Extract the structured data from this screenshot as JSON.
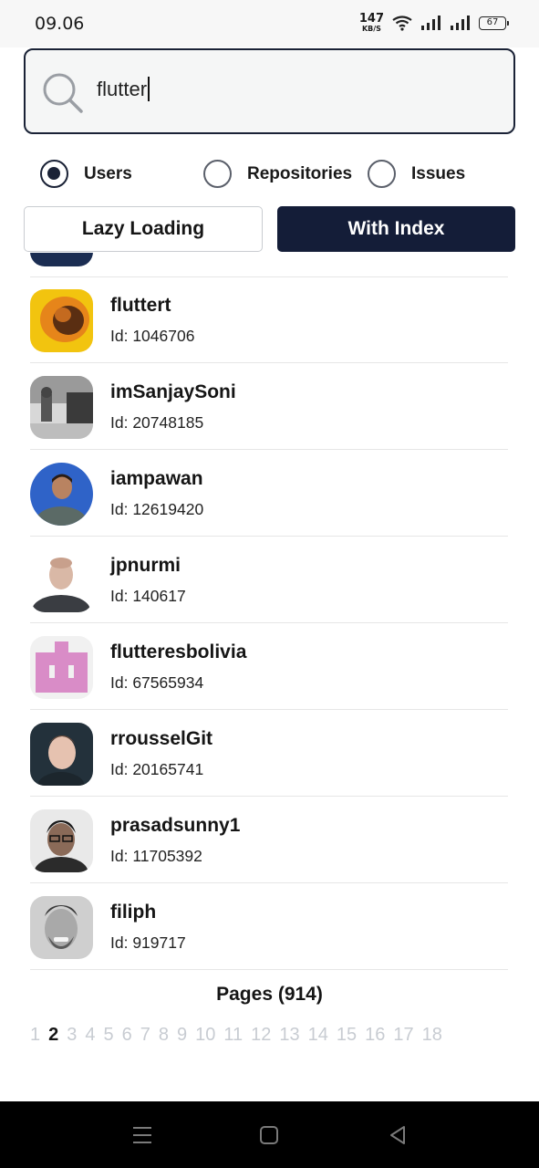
{
  "status_bar": {
    "time": "09.06",
    "net_speed_value": "147",
    "net_speed_unit": "KB/S",
    "battery": "67"
  },
  "search": {
    "value": "flutter",
    "icon": "search-icon"
  },
  "search_type": {
    "selected": "Users",
    "options": [
      {
        "label": "Users",
        "selected": true
      },
      {
        "label": "Repositories",
        "selected": false
      },
      {
        "label": "Issues",
        "selected": false
      }
    ]
  },
  "mode_buttons": {
    "lazy_label": "Lazy Loading",
    "index_label": "With Index",
    "active": "With Index"
  },
  "users": [
    {
      "name": "fluttert",
      "id": "Id: 1046706"
    },
    {
      "name": "imSanjaySoni",
      "id": "Id: 20748185"
    },
    {
      "name": "iampawan",
      "id": "Id: 12619420"
    },
    {
      "name": "jpnurmi",
      "id": "Id: 140617"
    },
    {
      "name": "flutteresbolivia",
      "id": "Id: 67565934"
    },
    {
      "name": "rrousselGit",
      "id": "Id: 20165741"
    },
    {
      "name": "prasadsunny1",
      "id": "Id: 11705392"
    },
    {
      "name": "filiph",
      "id": "Id: 919717"
    }
  ],
  "pagination": {
    "title": "Pages (914)",
    "current_page": 2,
    "pages": [
      "1",
      "2",
      "3",
      "4",
      "5",
      "6",
      "7",
      "8",
      "9",
      "10",
      "11",
      "12",
      "13",
      "14",
      "15",
      "16",
      "17",
      "18"
    ]
  },
  "nav_bar": {
    "icons": [
      "menu-icon",
      "home-icon",
      "back-icon"
    ]
  },
  "colors": {
    "accent": "#141d38",
    "inactive_page": "#c8ccd2"
  }
}
